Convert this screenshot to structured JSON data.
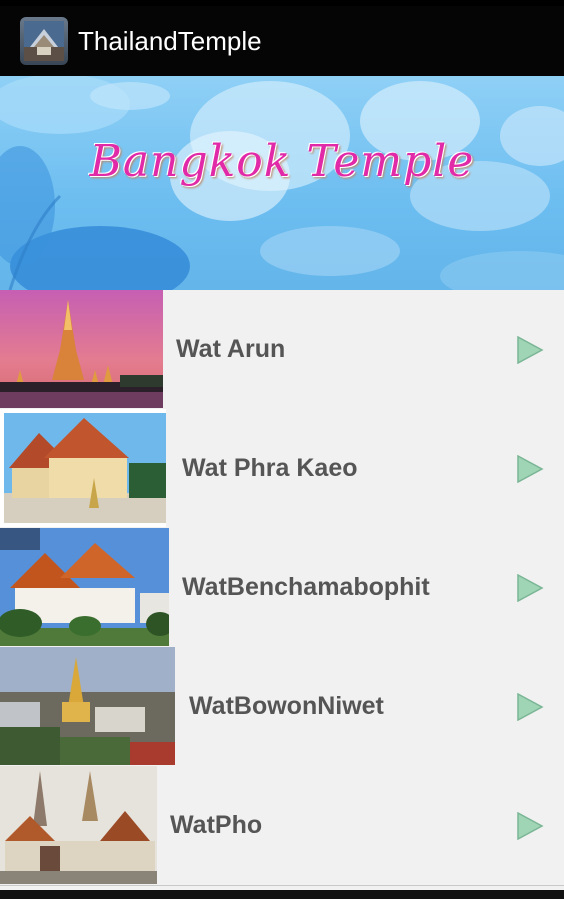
{
  "actionbar": {
    "title": "ThailandTemple",
    "icon": "temple-app-icon"
  },
  "banner": {
    "title": "Bangkok  Temple"
  },
  "temples": [
    {
      "name": "Wat Arun",
      "icon": "play-arrow-icon"
    },
    {
      "name": "Wat Phra Kaeo",
      "icon": "play-arrow-icon"
    },
    {
      "name": "WatBenchamabophit",
      "icon": "play-arrow-icon"
    },
    {
      "name": "WatBowonNiwet",
      "icon": "play-arrow-icon"
    },
    {
      "name": "WatPho",
      "icon": "play-arrow-icon"
    }
  ],
  "colors": {
    "accent_arrow": "#8fc9a8",
    "banner_text": "#e02aa8",
    "actionbar_bg": "#050505",
    "list_bg": "#f1f1f1"
  }
}
